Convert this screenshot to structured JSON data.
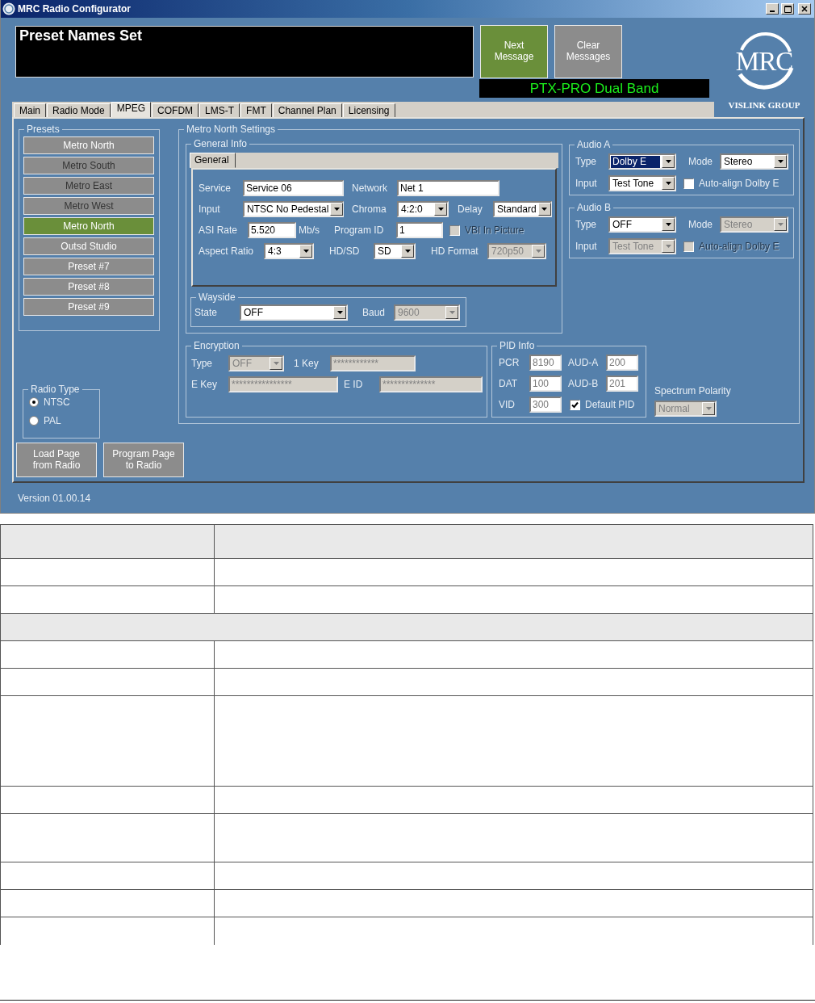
{
  "window": {
    "title": "MRC Radio Configurator"
  },
  "message": "Preset Names Set",
  "message_buttons": [
    {
      "label": "Next Message",
      "active": true
    },
    {
      "label": "Clear Messages",
      "active": false
    }
  ],
  "model": "PTX-PRO Dual Band",
  "logo": {
    "mark": "MRC",
    "tagline": "VISLINK GROUP"
  },
  "tabs": [
    {
      "label": "Main",
      "selected": false
    },
    {
      "label": "Radio Mode",
      "selected": false
    },
    {
      "label": "MPEG",
      "selected": true
    },
    {
      "label": "COFDM",
      "selected": false
    },
    {
      "label": "LMS-T",
      "selected": false
    },
    {
      "label": "FMT",
      "selected": false
    },
    {
      "label": "Channel Plan",
      "selected": false
    },
    {
      "label": "Licensing",
      "selected": false
    }
  ],
  "presets": {
    "title": "Presets",
    "items": [
      {
        "label": "Metro North",
        "selected": false,
        "dimmed": false
      },
      {
        "label": "Metro South",
        "selected": false,
        "dimmed": true
      },
      {
        "label": "Metro East",
        "selected": false,
        "dimmed": true
      },
      {
        "label": "Metro West",
        "selected": false,
        "dimmed": true
      },
      {
        "label": "Metro North",
        "selected": true,
        "dimmed": false
      },
      {
        "label": "Outsd Studio",
        "selected": false,
        "dimmed": false
      },
      {
        "label": "Preset #7",
        "selected": false,
        "dimmed": false
      },
      {
        "label": "Preset #8",
        "selected": false,
        "dimmed": false
      },
      {
        "label": "Preset #9",
        "selected": false,
        "dimmed": false
      }
    ]
  },
  "settings": {
    "title": "Metro North Settings",
    "general_info": {
      "title": "General Info",
      "tab": "General",
      "service": {
        "label": "Service",
        "value": "Service 06"
      },
      "network": {
        "label": "Network",
        "value": "Net 1"
      },
      "input": {
        "label": "Input",
        "value": "NTSC No Pedestal"
      },
      "chroma": {
        "label": "Chroma",
        "value": "4:2:0"
      },
      "delay": {
        "label": "Delay",
        "value": "Standard"
      },
      "asi_rate": {
        "label": "ASI Rate",
        "value": "5.520",
        "unit": "Mb/s"
      },
      "program_id": {
        "label": "Program ID",
        "value": "1"
      },
      "vbi_in_picture": {
        "label": "VBI In Picture",
        "checked": false,
        "disabled": true
      },
      "aspect_ratio": {
        "label": "Aspect Ratio",
        "value": "4:3"
      },
      "hd_sd": {
        "label": "HD/SD",
        "value": "SD"
      },
      "hd_format": {
        "label": "HD Format",
        "value": "720p50",
        "disabled": true
      }
    },
    "wayside": {
      "title": "Wayside",
      "state": {
        "label": "State",
        "value": "OFF"
      },
      "baud": {
        "label": "Baud",
        "value": "9600",
        "disabled": true
      }
    },
    "audio_a": {
      "title": "Audio A",
      "type": {
        "label": "Type",
        "value": "Dolby E",
        "highlighted": true
      },
      "mode": {
        "label": "Mode",
        "value": "Stereo"
      },
      "input": {
        "label": "Input",
        "value": "Test Tone"
      },
      "auto_align": {
        "label": "Auto-align Dolby E",
        "checked": false
      }
    },
    "audio_b": {
      "title": "Audio B",
      "type": {
        "label": "Type",
        "value": "OFF"
      },
      "mode": {
        "label": "Mode",
        "value": "Stereo",
        "disabled": true
      },
      "input": {
        "label": "Input",
        "value": "Test Tone",
        "disabled": true
      },
      "auto_align": {
        "label": "Auto-align Dolby E",
        "checked": false,
        "disabled": true
      }
    },
    "encryption": {
      "title": "Encryption",
      "type": {
        "label": "Type",
        "value": "OFF",
        "disabled": true
      },
      "key_1": {
        "label": "1 Key",
        "value": "************",
        "disabled": true
      },
      "e_key": {
        "label": "E Key",
        "value": "****************",
        "disabled": true
      },
      "e_id": {
        "label": "E ID",
        "value": "**************",
        "disabled": true
      }
    },
    "pid_info": {
      "title": "PID Info",
      "pcr": {
        "label": "PCR",
        "value": "8190"
      },
      "aud_a": {
        "label": "AUD-A",
        "value": "200"
      },
      "dat": {
        "label": "DAT",
        "value": "100"
      },
      "aud_b": {
        "label": "AUD-B",
        "value": "201"
      },
      "vid": {
        "label": "VID",
        "value": "300"
      },
      "default_pid": {
        "label": "Default PID",
        "checked": true
      }
    },
    "spectrum_polarity": {
      "label": "Spectrum Polarity",
      "value": "Normal",
      "disabled": true
    }
  },
  "radio_type": {
    "title": "Radio Type",
    "options": [
      {
        "label": "NTSC",
        "selected": true
      },
      {
        "label": "PAL",
        "selected": false
      }
    ]
  },
  "page_buttons": [
    {
      "label": "Load Page from Radio"
    },
    {
      "label": "Program Page to Radio"
    }
  ],
  "version": "Version 01.00.14",
  "doc_table": {
    "rows": [
      {
        "kind": "header"
      },
      {
        "kind": "single"
      },
      {
        "kind": "single"
      },
      {
        "kind": "section"
      },
      {
        "kind": "single"
      },
      {
        "kind": "single"
      },
      {
        "kind": "quadruple"
      },
      {
        "kind": "single"
      },
      {
        "kind": "double"
      },
      {
        "kind": "single"
      },
      {
        "kind": "single"
      },
      {
        "kind": "partial"
      }
    ]
  }
}
